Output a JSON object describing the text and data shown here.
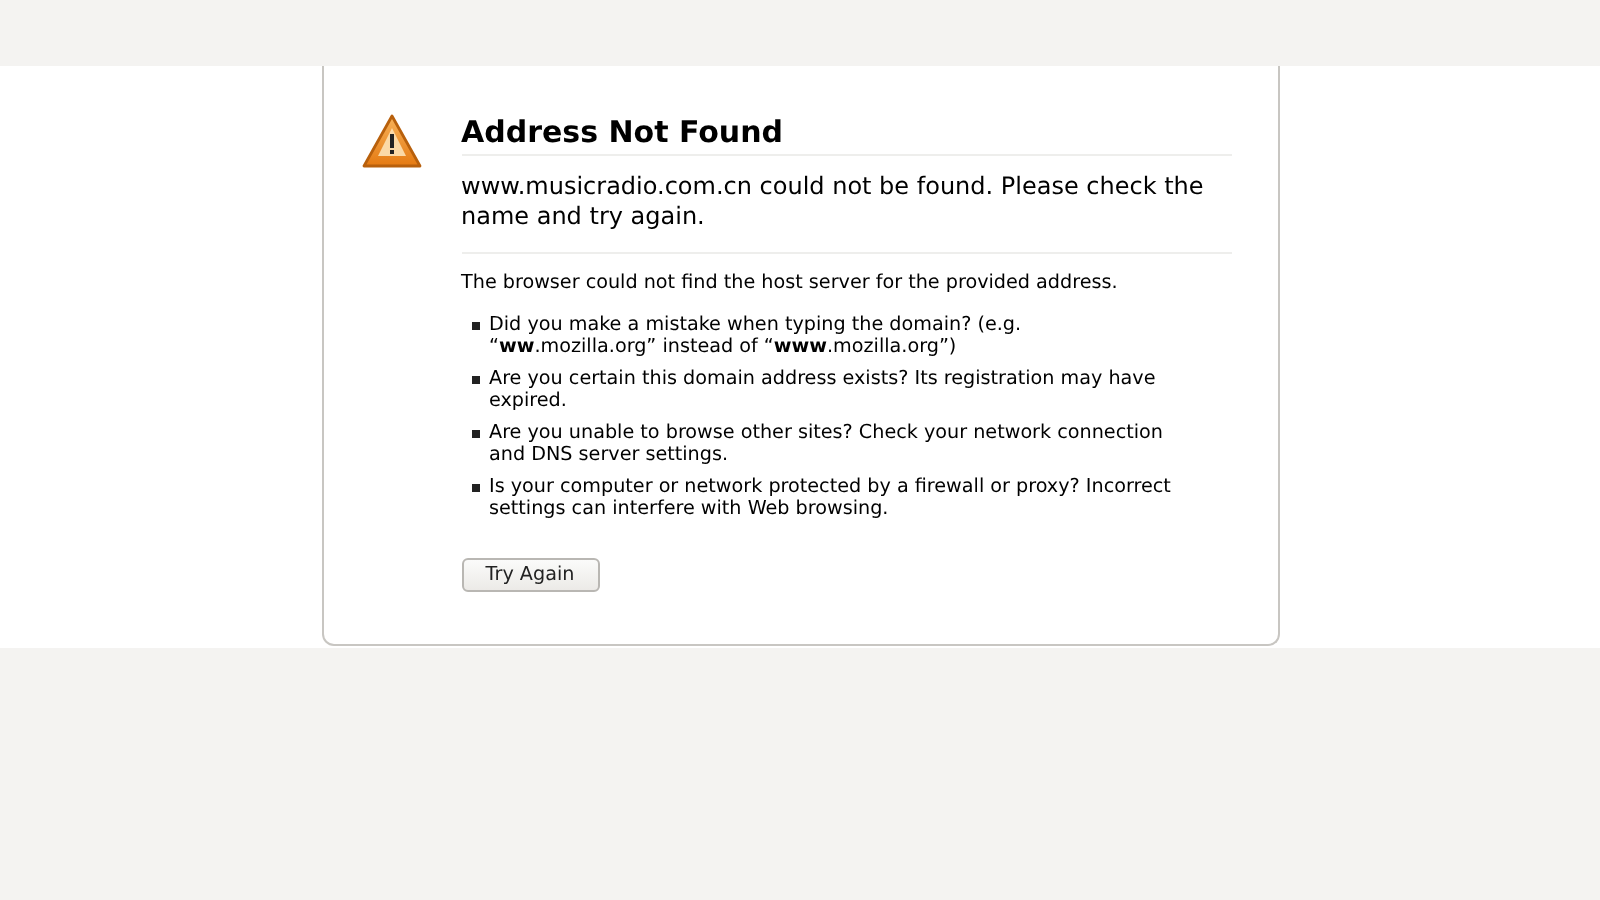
{
  "title": "Address Not Found",
  "message": "www.musicradio.com.cn could not be found. Please check the name and try again.",
  "description": "The browser could not find the host server for the provided address.",
  "suggestions": [
    "Did you make a mistake when typing the domain? (e.g. “**ww**.mozilla.org” instead of “**www**.mozilla.org”)",
    "Are you certain this domain address exists? Its registration may have expired.",
    "Are you unable to browse other sites? Check your network connection and DNS server settings.",
    "Is your computer or network protected by a firewall or proxy? Incorrect settings can interfere with Web browsing."
  ],
  "button": "Try Again"
}
